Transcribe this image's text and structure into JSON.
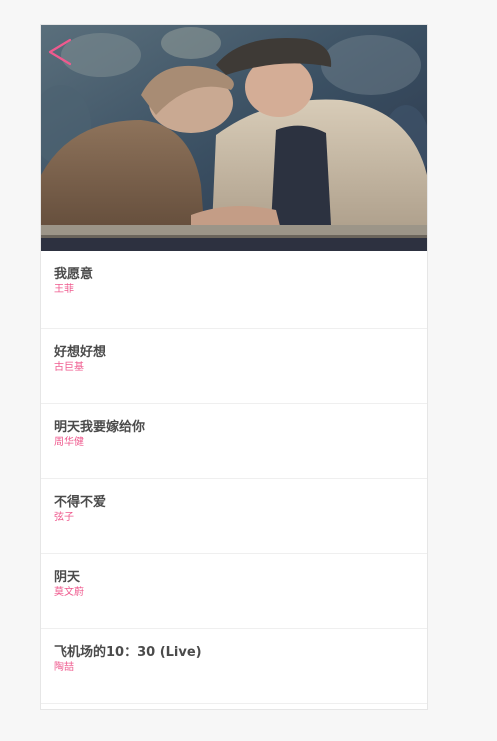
{
  "colors": {
    "accent": "#ef5a8e",
    "title_text": "#4b4b4b",
    "background": "#f7f7f7",
    "card": "#ffffff"
  },
  "header": {
    "back_icon": "chevron-left-icon",
    "photo": "elderly-couple-embracing-photo"
  },
  "songs": [
    {
      "title": "我愿意",
      "artist": "王菲"
    },
    {
      "title": "好想好想",
      "artist": "古巨基"
    },
    {
      "title": "明天我要嫁给你",
      "artist": "周华健"
    },
    {
      "title": "不得不爱",
      "artist": "弦子"
    },
    {
      "title": "阴天",
      "artist": "莫文蔚"
    },
    {
      "title": "飞机场的10：30 (Live)",
      "artist": "陶喆"
    }
  ]
}
